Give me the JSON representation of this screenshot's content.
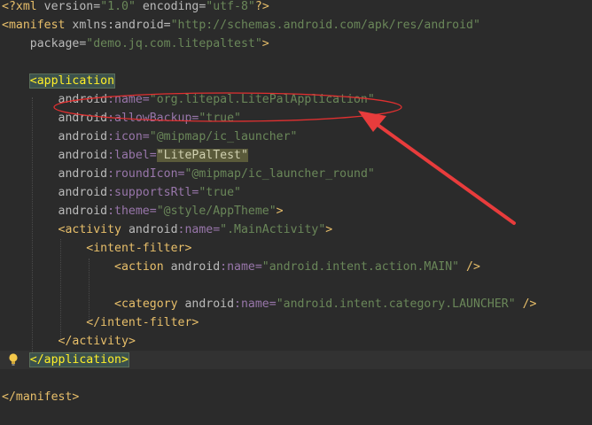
{
  "lines": [
    {
      "parts": [
        [
          "lt",
          "<?"
        ],
        [
          "tag",
          "xml "
        ],
        [
          "attr",
          "version="
        ],
        [
          "val",
          "\"1.0\""
        ],
        [
          "attr",
          " encoding="
        ],
        [
          "val",
          "\"utf-8\""
        ],
        [
          "lt",
          "?>"
        ]
      ]
    },
    {
      "parts": [
        [
          "lt",
          "<"
        ],
        [
          "tag",
          "manifest "
        ],
        [
          "attr",
          "xmlns:"
        ],
        [
          "attr",
          "android="
        ],
        [
          "val",
          "\"http://schemas.android.com/apk/res/android\""
        ]
      ]
    },
    {
      "parts": [
        [
          "plain",
          "    "
        ],
        [
          "attr",
          "package="
        ],
        [
          "val",
          "\"demo.jq.com.litepaltest\""
        ],
        [
          "lt",
          ">"
        ]
      ]
    },
    {
      "parts": []
    },
    {
      "parts": [
        [
          "plain",
          "    "
        ],
        [
          "brace-hl",
          "<application"
        ]
      ]
    },
    {
      "parts": [
        [
          "plain",
          "        "
        ],
        [
          "attr",
          "android"
        ],
        [
          "ns",
          ":name="
        ],
        [
          "val",
          "\"org.litepal.LitePalApplication\""
        ]
      ]
    },
    {
      "parts": [
        [
          "plain",
          "        "
        ],
        [
          "attr",
          "android"
        ],
        [
          "ns",
          ":allowBackup="
        ],
        [
          "val",
          "\"true\""
        ]
      ]
    },
    {
      "parts": [
        [
          "plain",
          "        "
        ],
        [
          "attr",
          "android"
        ],
        [
          "ns",
          ":icon="
        ],
        [
          "val",
          "\"@mipmap/ic_launcher\""
        ]
      ]
    },
    {
      "parts": [
        [
          "plain",
          "        "
        ],
        [
          "attr",
          "android"
        ],
        [
          "ns",
          ":label="
        ],
        [
          "sel",
          "\"LitePalTest\""
        ]
      ]
    },
    {
      "parts": [
        [
          "plain",
          "        "
        ],
        [
          "attr",
          "android"
        ],
        [
          "ns",
          ":roundIcon="
        ],
        [
          "val",
          "\"@mipmap/ic_launcher_round\""
        ]
      ]
    },
    {
      "parts": [
        [
          "plain",
          "        "
        ],
        [
          "attr",
          "android"
        ],
        [
          "ns",
          ":supportsRtl="
        ],
        [
          "val",
          "\"true\""
        ]
      ]
    },
    {
      "parts": [
        [
          "plain",
          "        "
        ],
        [
          "attr",
          "android"
        ],
        [
          "ns",
          ":theme="
        ],
        [
          "val",
          "\"@style/AppTheme\""
        ],
        [
          "lt",
          ">"
        ]
      ]
    },
    {
      "parts": [
        [
          "plain",
          "        "
        ],
        [
          "lt",
          "<"
        ],
        [
          "tag",
          "activity "
        ],
        [
          "attr",
          "android"
        ],
        [
          "ns",
          ":name="
        ],
        [
          "val",
          "\".MainActivity\""
        ],
        [
          "lt",
          ">"
        ]
      ]
    },
    {
      "parts": [
        [
          "plain",
          "            "
        ],
        [
          "lt",
          "<"
        ],
        [
          "tag",
          "intent-filter"
        ],
        [
          "lt",
          ">"
        ]
      ]
    },
    {
      "parts": [
        [
          "plain",
          "                "
        ],
        [
          "lt",
          "<"
        ],
        [
          "tag",
          "action "
        ],
        [
          "attr",
          "android"
        ],
        [
          "ns",
          ":name="
        ],
        [
          "val",
          "\"android.intent.action.MAIN\""
        ],
        [
          "lt",
          " />"
        ]
      ]
    },
    {
      "parts": []
    },
    {
      "parts": [
        [
          "plain",
          "                "
        ],
        [
          "lt",
          "<"
        ],
        [
          "tag",
          "category "
        ],
        [
          "attr",
          "android"
        ],
        [
          "ns",
          ":name="
        ],
        [
          "val",
          "\"android.intent.category.LAUNCHER\""
        ],
        [
          "lt",
          " />"
        ]
      ]
    },
    {
      "parts": [
        [
          "plain",
          "            "
        ],
        [
          "lt",
          "</"
        ],
        [
          "tag",
          "intent-filter"
        ],
        [
          "lt",
          ">"
        ]
      ]
    },
    {
      "parts": [
        [
          "plain",
          "        "
        ],
        [
          "lt",
          "</"
        ],
        [
          "tag",
          "activity"
        ],
        [
          "lt",
          ">"
        ]
      ]
    },
    {
      "parts": [
        [
          "plain",
          "    "
        ],
        [
          "brace-hl",
          "</application>"
        ]
      ]
    },
    {
      "parts": []
    },
    {
      "parts": [
        [
          "lt",
          "</"
        ],
        [
          "tag",
          "manifest"
        ],
        [
          "lt",
          ">"
        ]
      ]
    }
  ],
  "current_line": 19,
  "colors": {
    "background": "#2b2b2b",
    "tag": "#e8bf6a",
    "namespace_attr": "#9876aa",
    "string": "#6a8759",
    "annotation_ellipse": "#e03030",
    "annotation_arrow": "#e83c3c"
  },
  "icons": {
    "intention": "lightbulb-icon",
    "annotation_ellipse": "ellipse-highlight",
    "annotation_arrow": "arrow-pointer"
  }
}
